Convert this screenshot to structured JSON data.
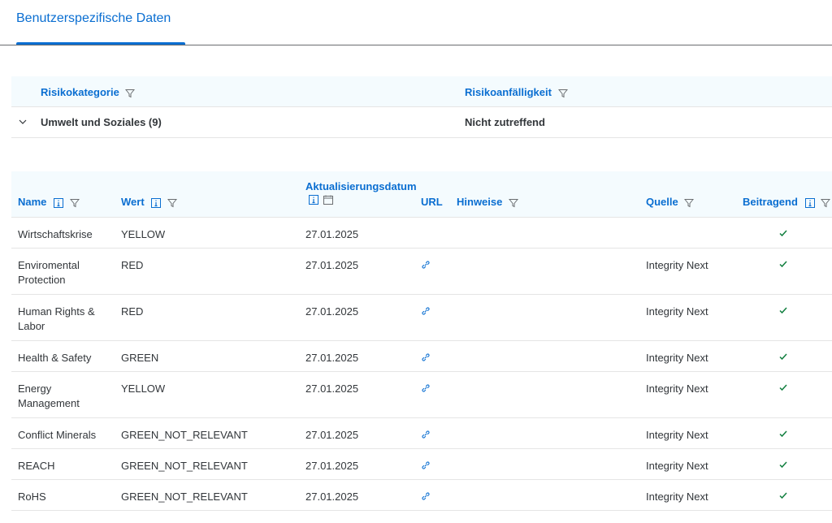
{
  "tabs": [
    {
      "label": "Benutzerspezifische Daten",
      "selected": true
    }
  ],
  "group_table": {
    "columns": [
      "Risikokategorie",
      "Risikoanfälligkeit"
    ],
    "rows": [
      {
        "category": "Umwelt und Soziales (9)",
        "susceptibility": "Nicht zutreffend",
        "expanded": true
      }
    ]
  },
  "data_table": {
    "columns": {
      "name": "Name",
      "wert": "Wert",
      "datum": "Aktualisierungsdatum",
      "url": "URL",
      "hinweise": "Hinweise",
      "quelle": "Quelle",
      "beitragend": "Beitragend"
    },
    "rows": [
      {
        "name": "Wirtschaftskrise",
        "wert": "YELLOW",
        "datum": "27.01.2025",
        "has_url": false,
        "quelle": "",
        "beitragend": true
      },
      {
        "name": "Enviromental Protection",
        "wert": "RED",
        "datum": "27.01.2025",
        "has_url": true,
        "quelle": "Integrity Next",
        "beitragend": true
      },
      {
        "name": "Human Rights & Labor",
        "wert": "RED",
        "datum": "27.01.2025",
        "has_url": true,
        "quelle": "Integrity Next",
        "beitragend": true
      },
      {
        "name": "Health & Safety",
        "wert": "GREEN",
        "datum": "27.01.2025",
        "has_url": true,
        "quelle": "Integrity Next",
        "beitragend": true
      },
      {
        "name": "Energy Management",
        "wert": "YELLOW",
        "datum": "27.01.2025",
        "has_url": true,
        "quelle": "Integrity Next",
        "beitragend": true
      },
      {
        "name": "Conflict Minerals",
        "wert": "GREEN_NOT_RELEVANT",
        "datum": "27.01.2025",
        "has_url": true,
        "quelle": "Integrity Next",
        "beitragend": true
      },
      {
        "name": "REACH",
        "wert": "GREEN_NOT_RELEVANT",
        "datum": "27.01.2025",
        "has_url": true,
        "quelle": "Integrity Next",
        "beitragend": true
      },
      {
        "name": "RoHS",
        "wert": "GREEN_NOT_RELEVANT",
        "datum": "27.01.2025",
        "has_url": true,
        "quelle": "Integrity Next",
        "beitragend": true
      }
    ]
  },
  "colors": {
    "accent": "#0a6ed1",
    "header_bg": "#f4fbfe",
    "check": "#107e3e",
    "text": "#32363a"
  },
  "icons": {
    "filter": "filter-icon",
    "info": "info-icon",
    "calendar": "calendar-icon",
    "link": "link-icon",
    "check": "checkmark-icon",
    "expand": "chevron-down-icon"
  }
}
